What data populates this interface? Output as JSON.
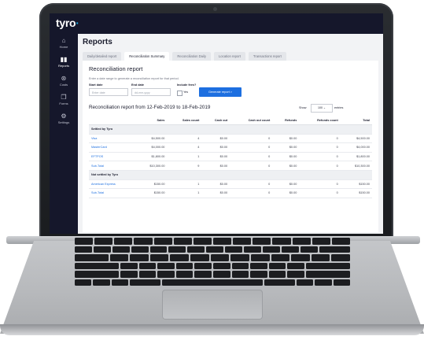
{
  "app": {
    "logo": "tyro"
  },
  "sidebar": {
    "items": [
      {
        "label": "Home",
        "icon": "home-icon",
        "glyph": "⌂"
      },
      {
        "label": "Reports",
        "icon": "bar-chart-icon",
        "glyph": "▮▮"
      },
      {
        "label": "Costs",
        "icon": "dollar-icon",
        "glyph": "⊛"
      },
      {
        "label": "Forms",
        "icon": "document-icon",
        "glyph": "❐"
      },
      {
        "label": "Settings",
        "icon": "gear-icon",
        "glyph": "⚙"
      }
    ]
  },
  "page": {
    "title": "Reports"
  },
  "tabs": [
    {
      "label": "Daily/detailed report"
    },
    {
      "label": "Reconciliation Summary"
    },
    {
      "label": "Reconciliation Daily"
    },
    {
      "label": "Location report"
    },
    {
      "label": "Transactions report"
    }
  ],
  "form": {
    "heading": "Reconciliation report",
    "hint": "Enter a date range to generate a reconciliation report for that period.",
    "start_label": "Start date",
    "start_value": "Enter date",
    "end_label": "End date",
    "end_value": "dd-mm-yyyy",
    "include_label": "Include fees?",
    "include_option": "Yes",
    "generate_button": "Generate report  >"
  },
  "report": {
    "title": "Reconciliation report from 12-Feb-2019 to 18-Feb-2019",
    "show_label": "Show",
    "show_value": "100  ⌄",
    "entries_label": "entries"
  },
  "table": {
    "columns": [
      "",
      "Sales",
      "Sales count",
      "Cash out",
      "Cash out count",
      "Refunds",
      "Refunds count",
      "Total"
    ],
    "rows": [
      {
        "type": "group",
        "cells": [
          "Settled by Tyro"
        ]
      },
      {
        "type": "row",
        "cells": [
          "Visa",
          "$4,500.00",
          "4",
          "$0.00",
          "0",
          "$0.00",
          "0",
          "$4,500.00"
        ]
      },
      {
        "type": "row",
        "cells": [
          "MasterCard",
          "$4,000.00",
          "4",
          "$0.00",
          "0",
          "$0.00",
          "0",
          "$4,000.00"
        ]
      },
      {
        "type": "row",
        "cells": [
          "EFTPOS",
          "$1,800.00",
          "1",
          "$0.00",
          "0",
          "$0.00",
          "0",
          "$1,800.00"
        ]
      },
      {
        "type": "row",
        "cells": [
          "Sub-Total",
          "$10,300.00",
          "9",
          "$0.00",
          "0",
          "$0.00",
          "0",
          "$10,300.00"
        ]
      },
      {
        "type": "group",
        "cells": [
          "Not settled by Tyro"
        ]
      },
      {
        "type": "row",
        "cells": [
          "American Express",
          "$150.00",
          "1",
          "$0.00",
          "0",
          "$0.00",
          "0",
          "$150.00"
        ]
      },
      {
        "type": "row",
        "cells": [
          "Sub-Total",
          "$150.00",
          "1",
          "$0.00",
          "0",
          "$0.00",
          "0",
          "$150.00"
        ]
      }
    ]
  },
  "colors": {
    "sidebar": "#15172b",
    "accent": "#1d6fe0",
    "logo_dot": "#18a8e0"
  }
}
